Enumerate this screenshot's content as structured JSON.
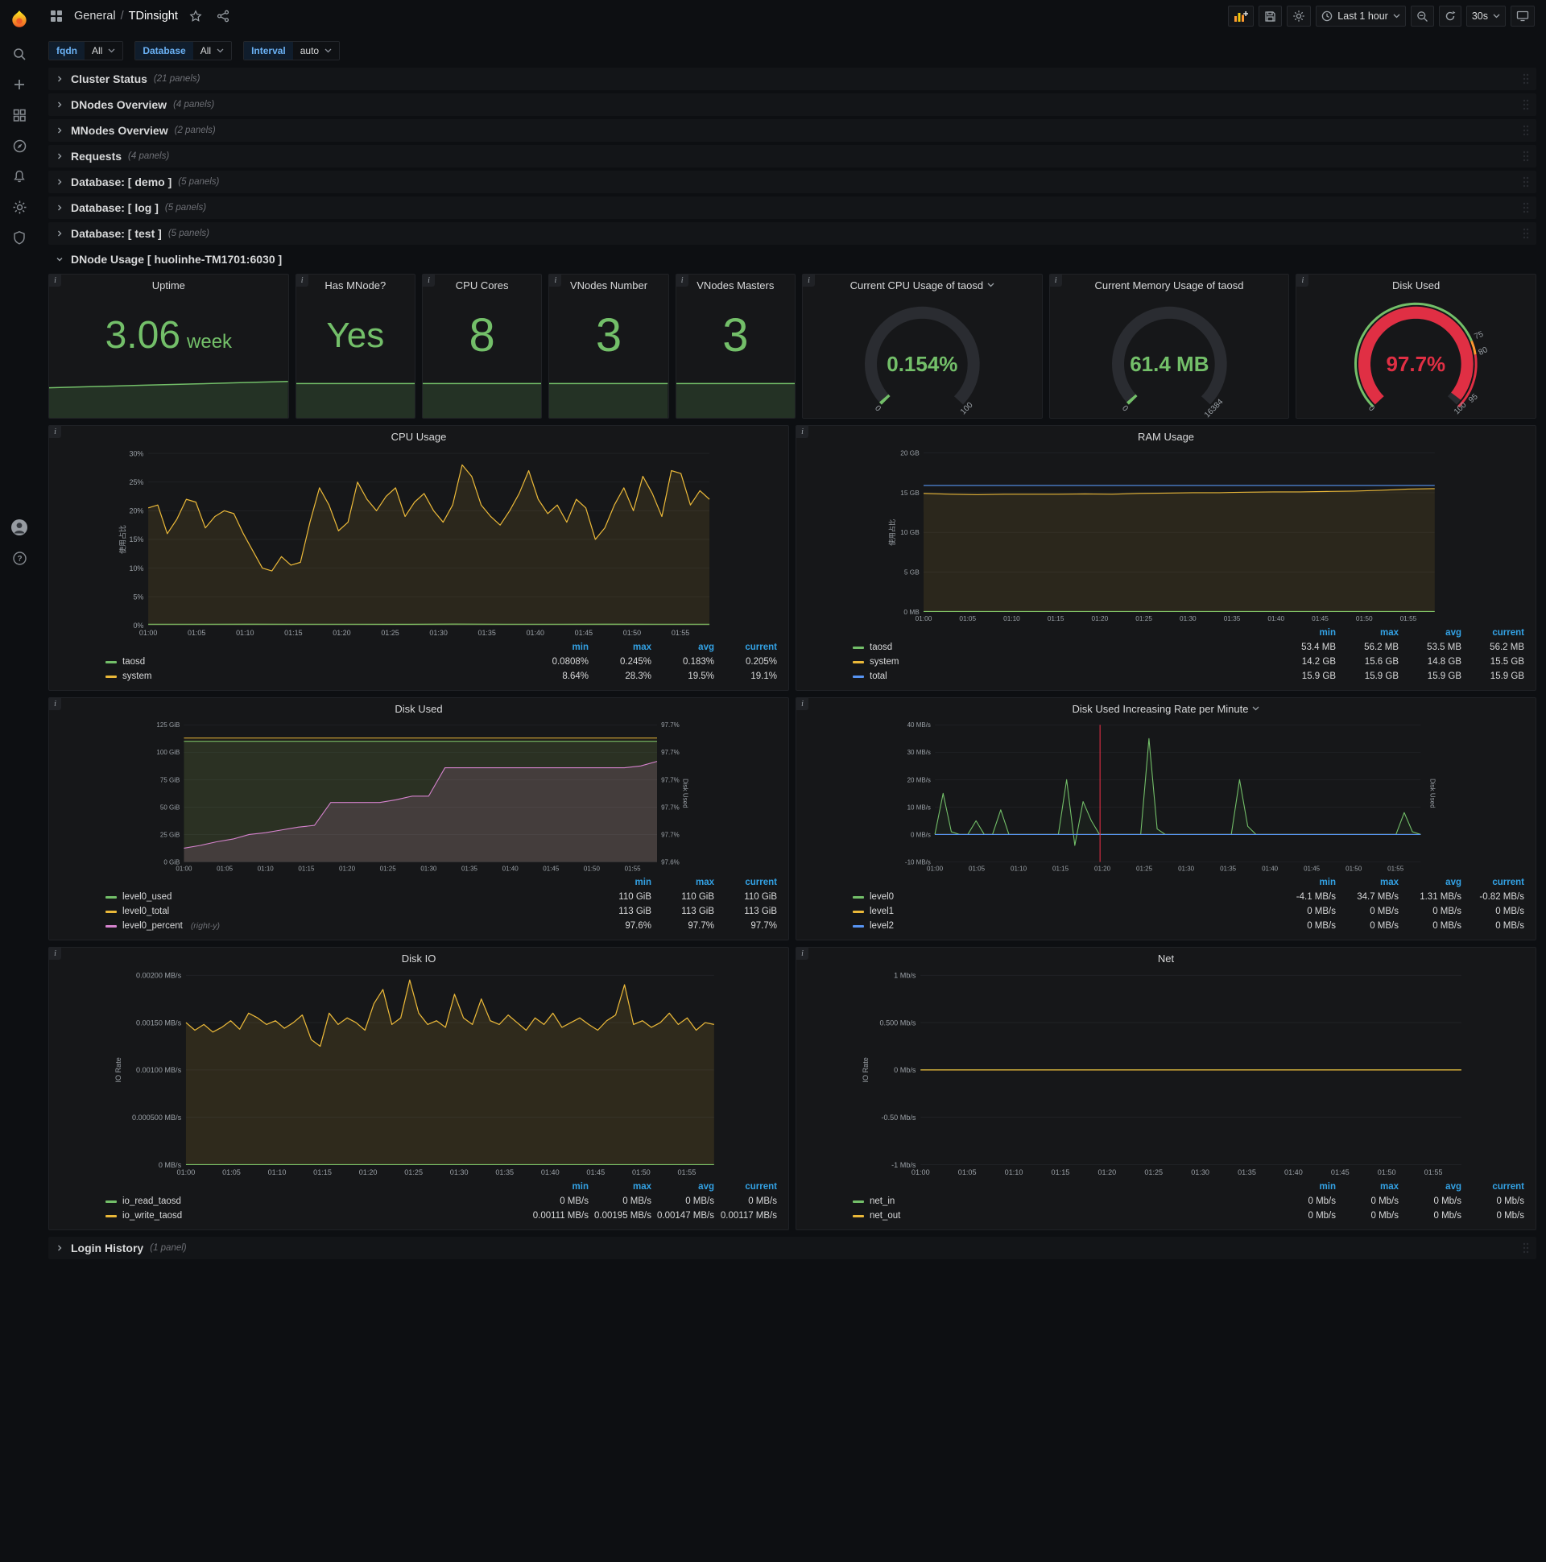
{
  "navbar": {
    "folder": "General",
    "separator": "/",
    "title": "TDinsight",
    "time_range": "Last 1 hour",
    "refresh": "30s"
  },
  "variables": [
    {
      "label": "fqdn",
      "value": "All"
    },
    {
      "label": "Database",
      "value": "All"
    },
    {
      "label": "Interval",
      "value": "auto"
    }
  ],
  "rows": [
    {
      "title": "Cluster Status",
      "count": "(21 panels)"
    },
    {
      "title": "DNodes Overview",
      "count": "(4 panels)"
    },
    {
      "title": "MNodes Overview",
      "count": "(2 panels)"
    },
    {
      "title": "Requests",
      "count": "(4 panels)"
    },
    {
      "title": "Database: [ demo ]",
      "count": "(5 panels)"
    },
    {
      "title": "Database: [ log ]",
      "count": "(5 panels)"
    },
    {
      "title": "Database: [ test ]",
      "count": "(5 panels)"
    }
  ],
  "expanded_row": {
    "title": "DNode Usage [ huolinhe-TM1701:6030 ]"
  },
  "login_row": {
    "title": "Login History",
    "count": "(1 panel)"
  },
  "stats": [
    {
      "title": "Uptime",
      "value": "3.06",
      "unit": "week",
      "spark": [
        0.72,
        0.75,
        0.78,
        0.81,
        0.84,
        0.87
      ]
    },
    {
      "title": "Has MNode?",
      "value": "Yes",
      "spark": [
        0.82,
        0.82,
        0.82,
        0.82
      ]
    },
    {
      "title": "CPU Cores",
      "value": "8",
      "spark": [
        0.82,
        0.82,
        0.82,
        0.82
      ]
    },
    {
      "title": "VNodes Number",
      "value": "3",
      "spark": [
        0.82,
        0.82,
        0.82,
        0.82
      ]
    },
    {
      "title": "VNodes Masters",
      "value": "3",
      "spark": [
        0.82,
        0.82,
        0.82,
        0.82
      ]
    }
  ],
  "gauges": [
    {
      "title": "Current CPU Usage of taosd",
      "caret": true,
      "value": "0.154%",
      "min_label": "0",
      "max_label": "100",
      "fraction": 0.0015,
      "color": "#73bf69",
      "value_color": "#73bf69"
    },
    {
      "title": "Current Memory Usage of taosd",
      "value": "61.4 MB",
      "min_label": "0",
      "max_label": "16384",
      "fraction": 0.0037,
      "color": "#73bf69",
      "value_color": "#73bf69"
    },
    {
      "title": "Disk Used",
      "value": "97.7%",
      "min_label": "0",
      "max_label": "100",
      "fraction": 0.977,
      "color": "#e02f44",
      "value_color": "#e02f44",
      "thresholds": [
        {
          "value": 75,
          "label": "75"
        },
        {
          "value": 80,
          "label": "80"
        },
        {
          "value": 95,
          "label": "95"
        }
      ],
      "threshold_colors": [
        {
          "to": 0.75,
          "color": "#73bf69"
        },
        {
          "to": 0.8,
          "color": "#ff9830"
        },
        {
          "to": 1,
          "color": "#e02f44"
        }
      ]
    }
  ],
  "time_ticks": [
    "01:00",
    "01:05",
    "01:10",
    "01:15",
    "01:20",
    "01:25",
    "01:30",
    "01:35",
    "01:40",
    "01:45",
    "01:50",
    "01:55"
  ],
  "colors": {
    "green": "#73bf69",
    "yellow": "#eab839",
    "blue": "#5794f2",
    "pink": "#d683ce",
    "red": "#e02f44",
    "legend_header": "#33a2e5"
  },
  "panels": [
    {
      "title": "CPU Usage",
      "type": "line",
      "y_label": "使用占比",
      "y_ticks": [
        "0%",
        "5%",
        "10%",
        "15%",
        "20%",
        "25%",
        "30%"
      ],
      "y_min": 0,
      "y_max": 30,
      "legend_cols": [
        "min",
        "max",
        "avg",
        "current"
      ],
      "series": [
        {
          "name": "taosd",
          "color": "#73bf69",
          "fill": 0.08,
          "points": [
            0.2,
            0.19,
            0.21,
            0.2,
            0.2,
            0.18,
            0.22,
            0.2,
            0.19,
            0.21,
            0.2,
            0.2
          ],
          "stats": [
            "0.0808%",
            "0.245%",
            "0.183%",
            "0.205%"
          ]
        },
        {
          "name": "system",
          "color": "#eab839",
          "fill": 0.1,
          "points": [
            20.5,
            21,
            16,
            18.5,
            22,
            21.5,
            17,
            19,
            20,
            19.5,
            16,
            13,
            10,
            9.5,
            12,
            10.5,
            11,
            18,
            24,
            21,
            16.5,
            18,
            25,
            22,
            20,
            22.5,
            24,
            19,
            21.5,
            23,
            20,
            18,
            21,
            28,
            26,
            21,
            19,
            17.5,
            20,
            23,
            27,
            22,
            19.5,
            21,
            18,
            22,
            20.5,
            15,
            17,
            21,
            24,
            20,
            26,
            23,
            19,
            27,
            26.5,
            21,
            23.5,
            22
          ],
          "stats": [
            "8.64%",
            "28.3%",
            "19.5%",
            "19.1%"
          ]
        }
      ]
    },
    {
      "title": "RAM Usage",
      "type": "line",
      "y_label": "使用占比",
      "y_ticks": [
        "0 MB",
        "5 GB",
        "10 GB",
        "15 GB",
        "20 GB"
      ],
      "y_min": 0,
      "y_max": 20,
      "legend_cols": [
        "min",
        "max",
        "avg",
        "current"
      ],
      "series": [
        {
          "name": "taosd",
          "color": "#73bf69",
          "fill": 0.06,
          "points": [
            0.055,
            0.055,
            0.055,
            0.055,
            0.055,
            0.055,
            0.055,
            0.055,
            0.055,
            0.055,
            0.055,
            0.055
          ],
          "stats": [
            "53.4 MB",
            "56.2 MB",
            "53.5 MB",
            "56.2 MB"
          ]
        },
        {
          "name": "system",
          "color": "#eab839",
          "fill": 0.1,
          "points": [
            14.9,
            14.8,
            14.75,
            14.8,
            14.8,
            14.8,
            14.85,
            14.8,
            14.9,
            14.95,
            15.0,
            15.0,
            15.05,
            15.1,
            15.1,
            15.15,
            15.2,
            15.3,
            15.45,
            15.5
          ],
          "stats": [
            "14.2 GB",
            "15.6 GB",
            "14.8 GB",
            "15.5 GB"
          ]
        },
        {
          "name": "total",
          "color": "#5794f2",
          "fill": 0,
          "points": [
            15.9,
            15.9,
            15.9,
            15.9,
            15.9,
            15.9,
            15.9,
            15.9,
            15.9,
            15.9,
            15.9,
            15.9
          ],
          "stats": [
            "15.9 GB",
            "15.9 GB",
            "15.9 GB",
            "15.9 GB"
          ]
        }
      ]
    },
    {
      "title": "Disk Used",
      "type": "line",
      "y_ticks": [
        "0 GiB",
        "25 GiB",
        "50 GiB",
        "75 GiB",
        "100 GiB",
        "125 GiB"
      ],
      "y_min": 0,
      "y_max": 125,
      "right_ticks": [
        "97.6%",
        "97.7%",
        "97.7%",
        "97.7%",
        "97.7%",
        "97.7%"
      ],
      "right_min": 97.58,
      "right_max": 97.73,
      "right_label": "Disk Used",
      "legend_cols": [
        "min",
        "max",
        "current"
      ],
      "series": [
        {
          "name": "level0_used",
          "color": "#73bf69",
          "fill": 0.12,
          "points": [
            110,
            110,
            110,
            110,
            110,
            110,
            110,
            110,
            110,
            110,
            110,
            110
          ],
          "stats": [
            "110 GiB",
            "110 GiB",
            "110 GiB"
          ]
        },
        {
          "name": "level0_total",
          "color": "#eab839",
          "fill": 0.05,
          "points": [
            113,
            113,
            113,
            113,
            113,
            113,
            113,
            113,
            113,
            113,
            113,
            113
          ],
          "stats": [
            "113 GiB",
            "113 GiB",
            "113 GiB"
          ]
        },
        {
          "name": "level0_percent",
          "suffix": "(right-y)",
          "color": "#d683ce",
          "fill": 0.15,
          "axis": "right",
          "points": [
            97.595,
            97.598,
            97.602,
            97.605,
            97.61,
            97.612,
            97.615,
            97.618,
            97.62,
            97.645,
            97.645,
            97.645,
            97.645,
            97.648,
            97.652,
            97.652,
            97.683,
            97.683,
            97.683,
            97.683,
            97.683,
            97.683,
            97.683,
            97.683,
            97.683,
            97.683,
            97.683,
            97.683,
            97.685,
            97.69
          ],
          "stats": [
            "97.6%",
            "97.7%",
            "97.7%"
          ]
        }
      ]
    },
    {
      "title": "Disk Used Increasing Rate per Minute",
      "type": "line",
      "caret": true,
      "y_ticks": [
        "-10 MB/s",
        "0 MB/s",
        "10 MB/s",
        "20 MB/s",
        "30 MB/s",
        "40 MB/s"
      ],
      "y_min": -10,
      "y_max": 40,
      "right_label": "Disk Used",
      "annotation": 0.34,
      "legend_cols": [
        "min",
        "max",
        "avg",
        "current"
      ],
      "series": [
        {
          "name": "level0",
          "color": "#73bf69",
          "fill": 0.05,
          "points": [
            0,
            15,
            1,
            0,
            0,
            5,
            0,
            0,
            9,
            0,
            0,
            0,
            0,
            0,
            0,
            0,
            20,
            -4,
            12,
            5,
            0,
            0,
            0,
            0,
            0,
            0,
            35,
            2,
            0,
            0,
            0,
            0,
            0,
            0,
            0,
            0,
            0,
            20,
            3,
            0,
            0,
            0,
            0,
            0,
            0,
            0,
            0,
            0,
            0,
            0,
            0,
            0,
            0,
            0,
            0,
            0,
            0,
            8,
            1,
            0
          ],
          "stats": [
            "-4.1 MB/s",
            "34.7 MB/s",
            "1.31 MB/s",
            "-0.82 MB/s"
          ]
        },
        {
          "name": "level1",
          "color": "#eab839",
          "fill": 0,
          "points": [
            0,
            0,
            0,
            0,
            0,
            0,
            0,
            0,
            0,
            0,
            0,
            0
          ],
          "stats": [
            "0 MB/s",
            "0 MB/s",
            "0 MB/s",
            "0 MB/s"
          ]
        },
        {
          "name": "level2",
          "color": "#5794f2",
          "fill": 0,
          "points": [
            0,
            0,
            0,
            0,
            0,
            0,
            0,
            0,
            0,
            0,
            0,
            0
          ],
          "stats": [
            "0 MB/s",
            "0 MB/s",
            "0 MB/s",
            "0 MB/s"
          ]
        }
      ]
    },
    {
      "title": "Disk IO",
      "type": "line",
      "y_label": "IO Rate",
      "y_ticks": [
        "0 MB/s",
        "0.000500 MB/s",
        "0.00100 MB/s",
        "0.00150 MB/s",
        "0.00200 MB/s"
      ],
      "y_min": 0,
      "y_max": 0.002,
      "legend_cols": [
        "min",
        "max",
        "avg",
        "current"
      ],
      "series": [
        {
          "name": "io_read_taosd",
          "color": "#73bf69",
          "fill": 0,
          "points": [
            0,
            0,
            0,
            0,
            0,
            0,
            0,
            0,
            0,
            0,
            0,
            0
          ],
          "stats": [
            "0 MB/s",
            "0 MB/s",
            "0 MB/s",
            "0 MB/s"
          ]
        },
        {
          "name": "io_write_taosd",
          "color": "#eab839",
          "fill": 0.12,
          "points": [
            0.0015,
            0.00142,
            0.00148,
            0.0014,
            0.00145,
            0.00152,
            0.00143,
            0.0016,
            0.00155,
            0.00148,
            0.00152,
            0.00144,
            0.0015,
            0.00158,
            0.00132,
            0.00125,
            0.0016,
            0.00148,
            0.00155,
            0.0015,
            0.00142,
            0.0017,
            0.00185,
            0.00148,
            0.00155,
            0.00195,
            0.0016,
            0.00148,
            0.00152,
            0.00145,
            0.0018,
            0.00155,
            0.00148,
            0.00175,
            0.00152,
            0.00148,
            0.00158,
            0.0015,
            0.00142,
            0.00155,
            0.00148,
            0.0016,
            0.00145,
            0.0015,
            0.00155,
            0.00148,
            0.00142,
            0.00152,
            0.00158,
            0.0019,
            0.00148,
            0.00152,
            0.00145,
            0.0015,
            0.0016,
            0.00148,
            0.00155,
            0.00142,
            0.0015,
            0.00148
          ],
          "stats": [
            "0.00111 MB/s",
            "0.00195 MB/s",
            "0.00147 MB/s",
            "0.00117 MB/s"
          ]
        }
      ]
    },
    {
      "title": "Net",
      "type": "line",
      "y_label": "IO Rate",
      "y_ticks": [
        "-1 Mb/s",
        "-0.50 Mb/s",
        "0 Mb/s",
        "0.500 Mb/s",
        "1 Mb/s"
      ],
      "y_min": -1,
      "y_max": 1,
      "legend_cols": [
        "min",
        "max",
        "avg",
        "current"
      ],
      "series": [
        {
          "name": "net_in",
          "color": "#73bf69",
          "fill": 0,
          "points": [
            0,
            0,
            0,
            0,
            0,
            0,
            0,
            0,
            0,
            0,
            0,
            0
          ],
          "stats": [
            "0 Mb/s",
            "0 Mb/s",
            "0 Mb/s",
            "0 Mb/s"
          ]
        },
        {
          "name": "net_out",
          "color": "#eab839",
          "fill": 0,
          "points": [
            0,
            0,
            0,
            0,
            0,
            0,
            0,
            0,
            0,
            0,
            0,
            0
          ],
          "stats": [
            "0 Mb/s",
            "0 Mb/s",
            "0 Mb/s",
            "0 Mb/s"
          ]
        }
      ]
    }
  ]
}
